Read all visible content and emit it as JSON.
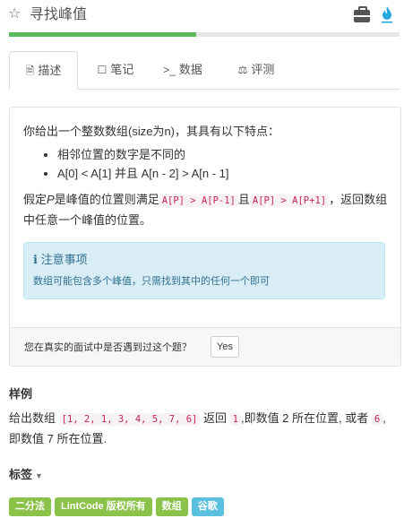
{
  "header": {
    "title": "寻找峰值",
    "star_icon": "star-outline-icon",
    "icons": [
      "briefcase-icon",
      "flame-icon"
    ],
    "progress": 0.48
  },
  "tabs": [
    {
      "label": "描述",
      "icon": "document-icon",
      "active": true
    },
    {
      "label": "笔记",
      "icon": "note-icon",
      "active": false
    },
    {
      "label": "数据",
      "icon": "terminal-icon",
      "active": false
    },
    {
      "label": "评测",
      "icon": "scale-icon",
      "active": false
    }
  ],
  "description": {
    "intro": "你给出一个整数数组(size为n)，其具有以下特点：",
    "bullets": [
      "相邻位置的数字是不同的",
      "A[0] < A[1] 并且 A[n - 2] > A[n - 1]"
    ],
    "para1_a": "假定",
    "para1_var": "P",
    "para1_b": "是峰值的位置则满足",
    "code1": "A[P] > A[P-1]",
    "para1_c": "且",
    "code2": "A[P] > A[P+1]",
    "para1_d": "，返回数组中任意一个峰值的位置。",
    "note_title": "注意事项",
    "note_text": "数组可能包含多个峰值，只需找到其中的任何一个即可",
    "footer_question": "您在真实的面试中是否遇到过这个题？",
    "yes_label": "Yes"
  },
  "example": {
    "heading": "样例",
    "text_a": "给出数组",
    "code_array": "[1, 2, 1, 3, 4, 5, 7, 6]",
    "text_b": "返回",
    "code_1": "1",
    "text_c": ",即数值 2 所在位置, 或者",
    "code_6": "6",
    "text_d": ",即数值 7 所在位置."
  },
  "tags_section": {
    "heading": "标签",
    "tags": [
      {
        "label": "二分法",
        "color": "#8bc34a"
      },
      {
        "label": "LintCode 版权所有",
        "color": "#8bc34a"
      },
      {
        "label": "数组",
        "color": "#8bc34a"
      },
      {
        "label": "谷歌",
        "color": "#5bc0de"
      }
    ]
  },
  "colors": {
    "progress": "#5cb85c",
    "note_bg": "#d9edf7",
    "code_text": "#c7254e"
  }
}
